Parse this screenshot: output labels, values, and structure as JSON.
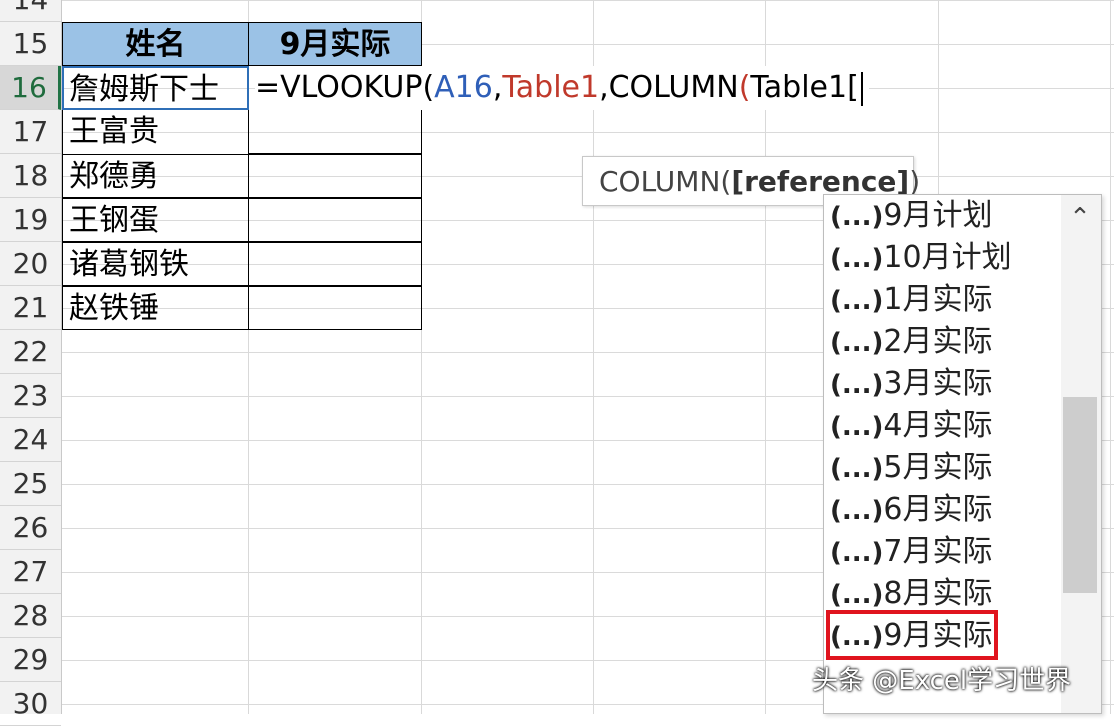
{
  "row_headers": [
    "14",
    "15",
    "16",
    "17",
    "18",
    "19",
    "20",
    "21",
    "22",
    "23",
    "24",
    "25",
    "26",
    "27",
    "28",
    "29",
    "30"
  ],
  "active_row": "16",
  "table": {
    "header_name": "姓名",
    "header_col2": "9月实际",
    "names": [
      "詹姆斯下士",
      "王富贵",
      "郑德勇",
      "王钢蛋",
      "诸葛钢铁",
      "赵铁锤"
    ]
  },
  "formula": {
    "part1": "=VLOOKUP(",
    "part2": "A16",
    "part3": ",",
    "part4": "Table1",
    "part5": ",COLUMN",
    "part6": "(",
    "part7": "Table1["
  },
  "tooltip": {
    "prefix": "COLUMN(",
    "arg": "[reference]",
    "suffix": ")"
  },
  "autocomplete": {
    "prefix": "(...)",
    "items": [
      "9月计划",
      "10月计划",
      "1月实际",
      "2月实际",
      "3月实际",
      "4月实际",
      "5月实际",
      "6月实际",
      "7月实际",
      "8月实际",
      "9月实际"
    ],
    "highlighted_index": 10
  },
  "scroll_up_glyph": "⌃",
  "watermark": "头条 @Excel学习世界",
  "colors": {
    "header_fill": "#9bc2e6",
    "selection_border": "#2f6fb7",
    "highlight_border": "#e0141e",
    "formula_ref": "#2f5fb8",
    "formula_table": "#c0392b"
  }
}
